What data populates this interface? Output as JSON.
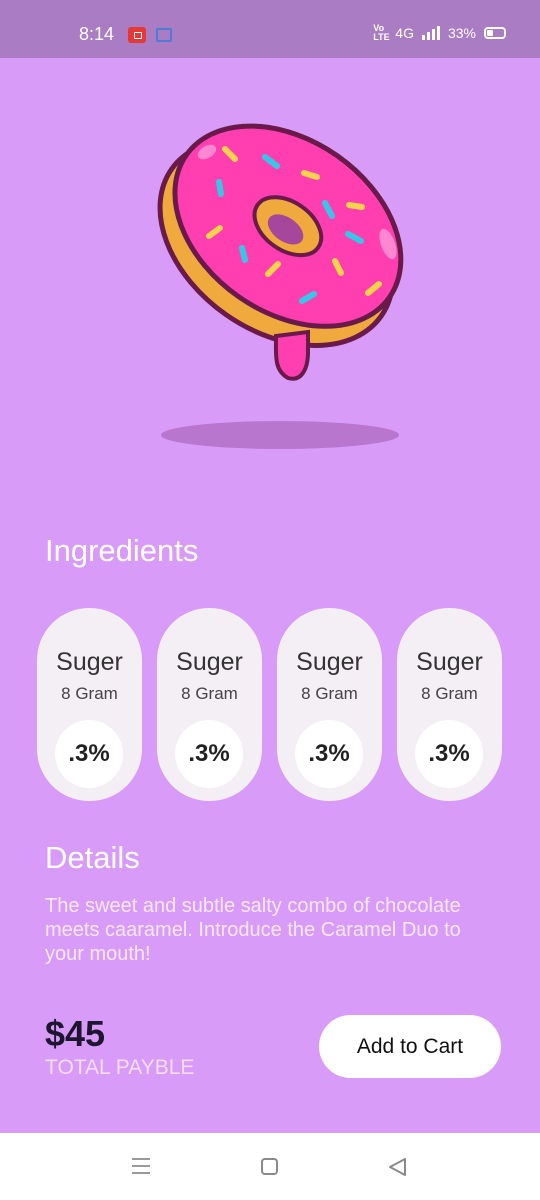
{
  "status_bar": {
    "time": "8:14",
    "network": "4G",
    "battery": "33%"
  },
  "hero": {
    "image": "donut-icon",
    "shadow": "donut-shadow"
  },
  "ingredients": {
    "title": "Ingredients",
    "items": [
      {
        "name": "Suger",
        "amount": "8 Gram",
        "percent": ".3%"
      },
      {
        "name": "Suger",
        "amount": "8 Gram",
        "percent": ".3%"
      },
      {
        "name": "Suger",
        "amount": "8 Gram",
        "percent": ".3%"
      },
      {
        "name": "Suger",
        "amount": "8 Gram",
        "percent": ".3%"
      }
    ]
  },
  "details": {
    "title": "Details",
    "text": "The sweet and subtle salty combo of chocolate meets caaramel. Introduce the Caramel Duo to your mouth!"
  },
  "checkout": {
    "price": "$45",
    "label": "TOTAL PAYBLE",
    "button": "Add to Cart"
  },
  "colors": {
    "background": "#d89bf8",
    "status_bar": "#a97cc3",
    "card": "#f3eff5",
    "text_dark": "#1e1530"
  },
  "nav": {
    "icons": [
      "menu-icon",
      "home-icon",
      "back-icon"
    ]
  }
}
